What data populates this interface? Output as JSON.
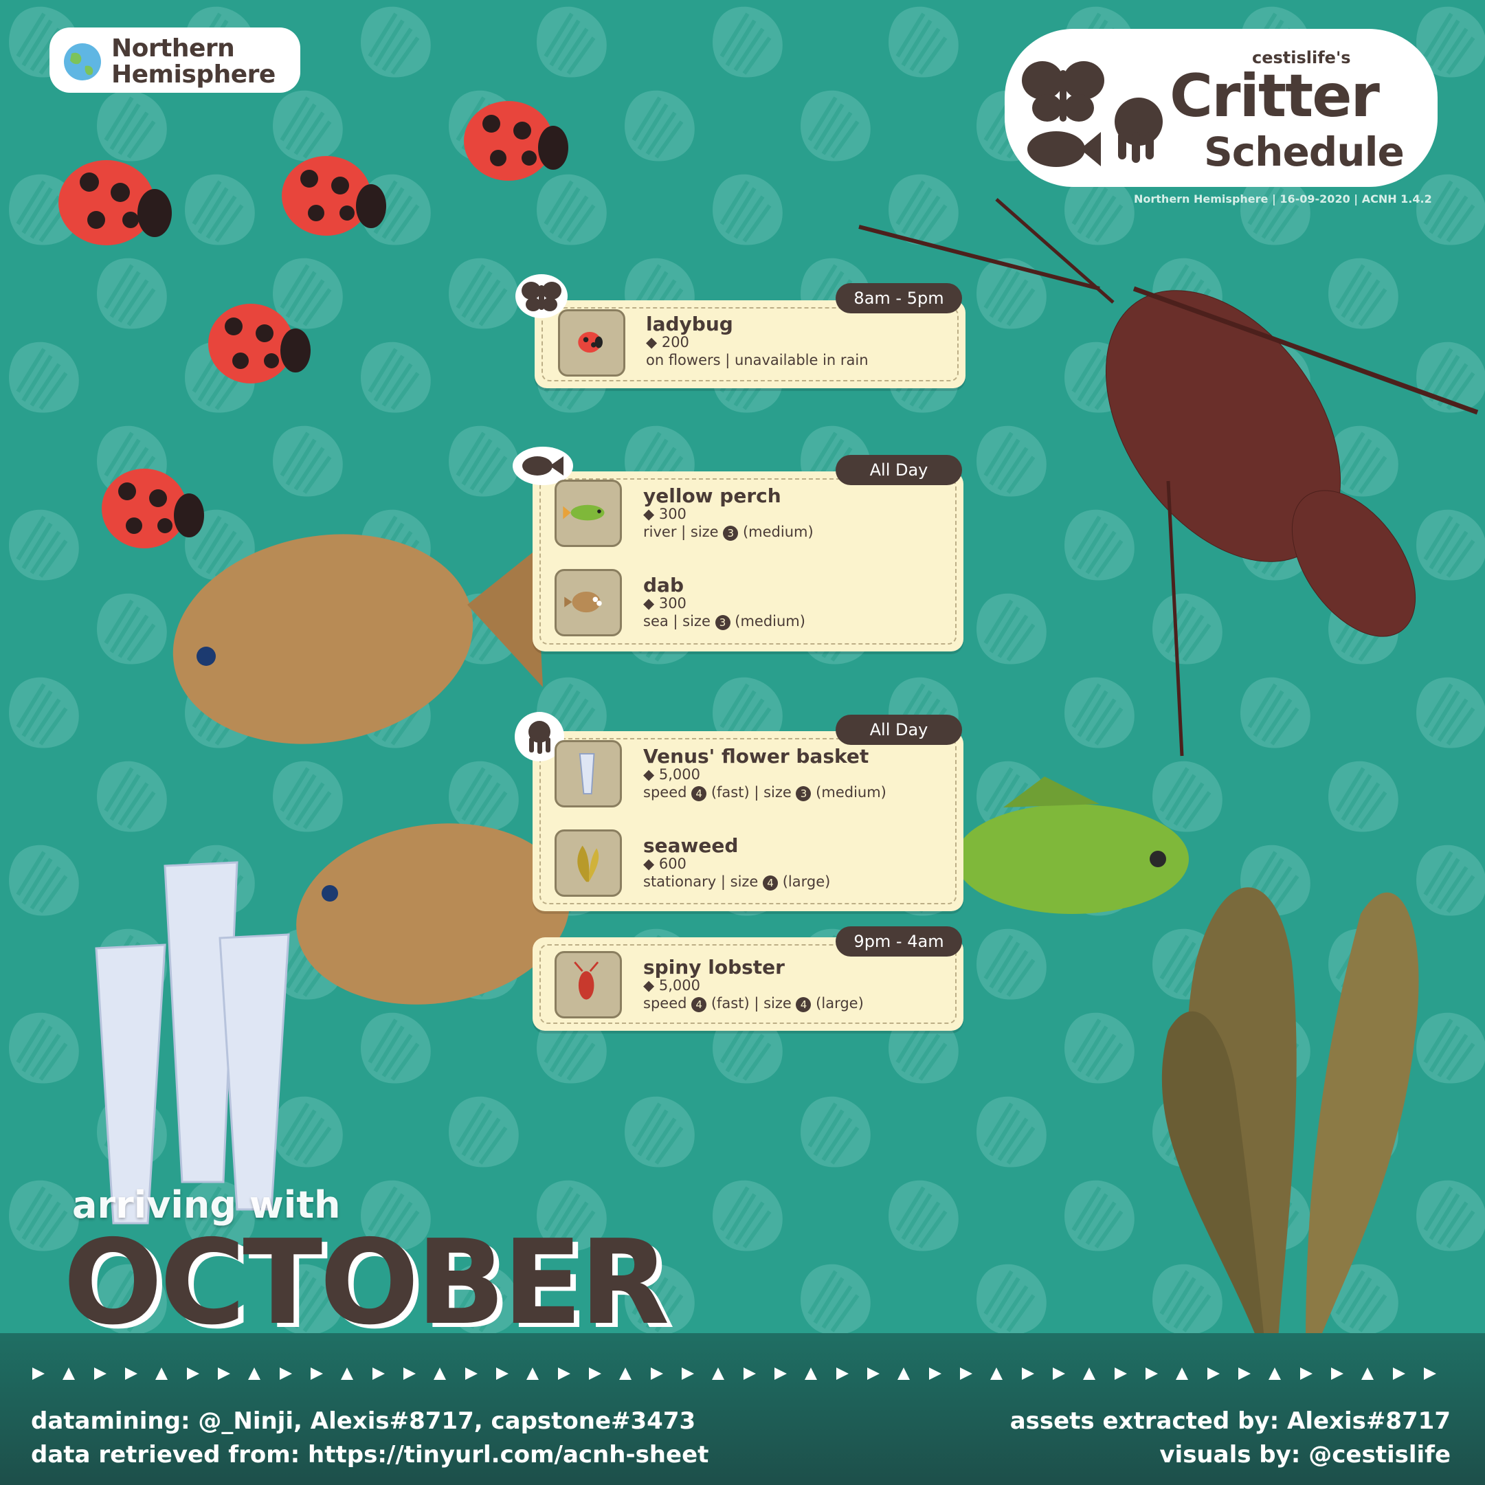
{
  "header": {
    "hemisphere_line1": "Northern",
    "hemisphere_line2": "Hemisphere",
    "logo_top": "cestislife's",
    "logo_main": "Critter",
    "logo_sub": "Schedule",
    "meta": "Northern Hemisphere | 16-09-2020 | ACNH 1.4.2"
  },
  "bug_group": {
    "category_icon": "butterfly-icon",
    "time": "8am - 5pm",
    "items": [
      {
        "name": "ladybug",
        "price": "200",
        "details": "on flowers | unavailable in rain",
        "icon": "ladybug-icon"
      }
    ]
  },
  "fish_group": {
    "category_icon": "fish-icon",
    "time": "All Day",
    "items": [
      {
        "name": "yellow perch",
        "price": "300",
        "details_pre": "river | size",
        "size_num": "3",
        "details_post": "(medium)",
        "icon": "yellow-perch-icon"
      },
      {
        "name": "dab",
        "price": "300",
        "details_pre": "sea | size",
        "size_num": "3",
        "details_post": "(medium)",
        "icon": "dab-icon"
      }
    ]
  },
  "sea_group": {
    "category_icon": "octopus-icon",
    "time_day": "All Day",
    "time_night": "9pm - 4am",
    "items": [
      {
        "name": "Venus' flower basket",
        "price": "5,000",
        "speed_pre": "speed",
        "speed_num": "4",
        "speed_post": "(fast) | size",
        "size_num": "3",
        "size_post": "(medium)",
        "icon": "flower-basket-icon"
      },
      {
        "name": "seaweed",
        "price": "600",
        "speed_pre": "stationary | size",
        "size_num": "4",
        "size_post": "(large)",
        "icon": "seaweed-icon"
      },
      {
        "name": "spiny lobster",
        "price": "5,000",
        "speed_pre": "speed",
        "speed_num": "4",
        "speed_post": "(fast) | size",
        "size_num": "4",
        "size_post": "(large)",
        "icon": "spiny-lobster-icon"
      }
    ]
  },
  "title": {
    "arriving": "arriving with",
    "month": "OCTOBER"
  },
  "footer": {
    "datamining": "datamining: @_Ninji, Alexis#8717, capstone#3473",
    "retrieved": "data retrieved from: https://tinyurl.com/acnh-sheet",
    "assets": "assets extracted by: Alexis#8717",
    "visuals": "visuals by: @cestislife"
  },
  "colors": {
    "background": "#2a9f8d",
    "card": "#fbf3cd",
    "dark_brown": "#4a3b36",
    "footer": "#1d4f4a"
  }
}
